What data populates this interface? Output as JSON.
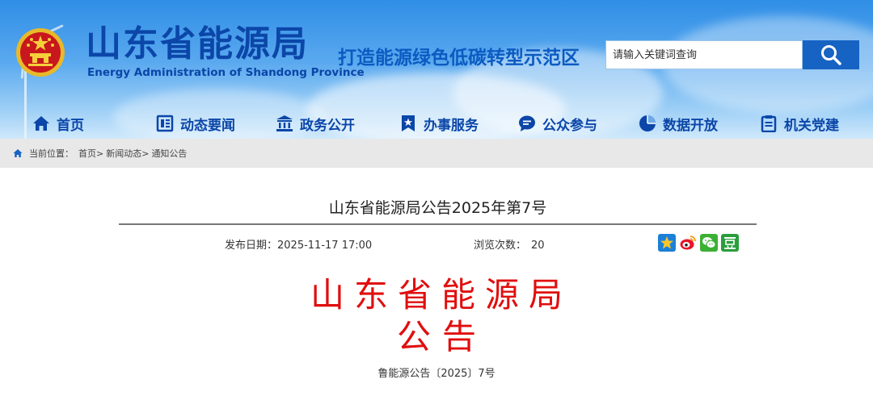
{
  "header": {
    "site_title": "山东省能源局",
    "site_subtitle": "Energy Administration of Shandong Province",
    "slogan": "打造能源绿色低碳转型示范区",
    "search": {
      "placeholder": "请输入关键词查询"
    }
  },
  "nav": {
    "items": [
      {
        "label": "首页",
        "icon": "home-icon"
      },
      {
        "label": "动态要闻",
        "icon": "news-icon"
      },
      {
        "label": "政务公开",
        "icon": "government-building-icon"
      },
      {
        "label": "办事服务",
        "icon": "bookmark-star-icon"
      },
      {
        "label": "公众参与",
        "icon": "chat-bubble-icon"
      },
      {
        "label": "数据开放",
        "icon": "pie-chart-icon"
      },
      {
        "label": "机关党建",
        "icon": "clipboard-icon"
      }
    ]
  },
  "breadcrumb": {
    "prefix": "当前位置：",
    "items": [
      "首页",
      "新闻动态",
      "通知公告"
    ],
    "separator": ">"
  },
  "article": {
    "title": "山东省能源局公告2025年第7号",
    "date_label": "发布日期：",
    "date": "2025-11-17 17:00",
    "views_label": "浏览次数：",
    "views": "20",
    "share_icons": [
      "qzone-star-icon",
      "weibo-icon",
      "wechat-icon",
      "douban-icon"
    ],
    "red_heading_line1": "山东省能源局",
    "red_heading_line2": "公告",
    "doc_number": "鲁能源公告〔2025〕7号"
  },
  "colors": {
    "brand_blue": "#0b46a8",
    "search_button": "#1763c4",
    "red_heading": "#e10e0e",
    "breadcrumb_bg": "#e8e8e8"
  }
}
